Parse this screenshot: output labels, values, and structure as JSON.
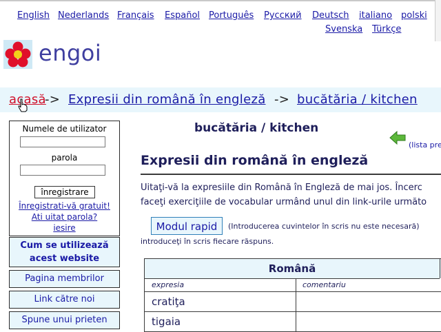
{
  "languages_row1": [
    "English",
    "Nederlands",
    "Français",
    "Español",
    "Português",
    "Русский",
    "Deutsch",
    "italiano",
    "polski"
  ],
  "languages_row2": [
    "Svenska",
    "Türkçe"
  ],
  "logo_text": "engoi",
  "breadcrumb": {
    "home": "acasă",
    "sep": "->",
    "section": "Expresii din română în engleză",
    "current": "bucătăria / kitchen"
  },
  "login": {
    "username_label": "Numele de utilizator",
    "password_label": "parola",
    "username_value": "",
    "password_value": "",
    "login_button": "înregistrare",
    "register_link": "Înregistrati-vă gratuit!",
    "forgot_link": "Ati uitat parola?",
    "exit_link": "iesire"
  },
  "sidebar": {
    "how_to_use": "Cum se utilizează acest website",
    "members_page": "Pagina membrilor",
    "link_to_us": "Link către noi",
    "tell_friend": "Spune unui prieten"
  },
  "main": {
    "page_title": "bucătăria / kitchen",
    "list_prev": "(lista pre",
    "section_title": "Expresii din română în engleză",
    "intro_line1": "Uitaţi-vă la expresiile din Română în Engleză de mai jos. Încerc",
    "intro_line2": "faceţi exerciţiile de vocabular urmând unul din link-urile următo",
    "quick_mode_button": "Modul rapid",
    "quick_mode_note1": "(Introducerea cuvintelor în scris nu este necesară)",
    "quick_mode_note2": "introduceţi în scris fiecare răspuns."
  },
  "table": {
    "header": "Română",
    "col_expression": "expresia",
    "col_comment": "comentariu",
    "rows": [
      {
        "expresia": "cratiţa",
        "comentariu": ""
      },
      {
        "expresia": "tigaia",
        "comentariu": ""
      }
    ]
  },
  "colors": {
    "accent_link": "#1a1aa6",
    "home_red": "#d0102a",
    "panel_bg": "#e8f6fc",
    "heading": "#1e1e5a"
  }
}
